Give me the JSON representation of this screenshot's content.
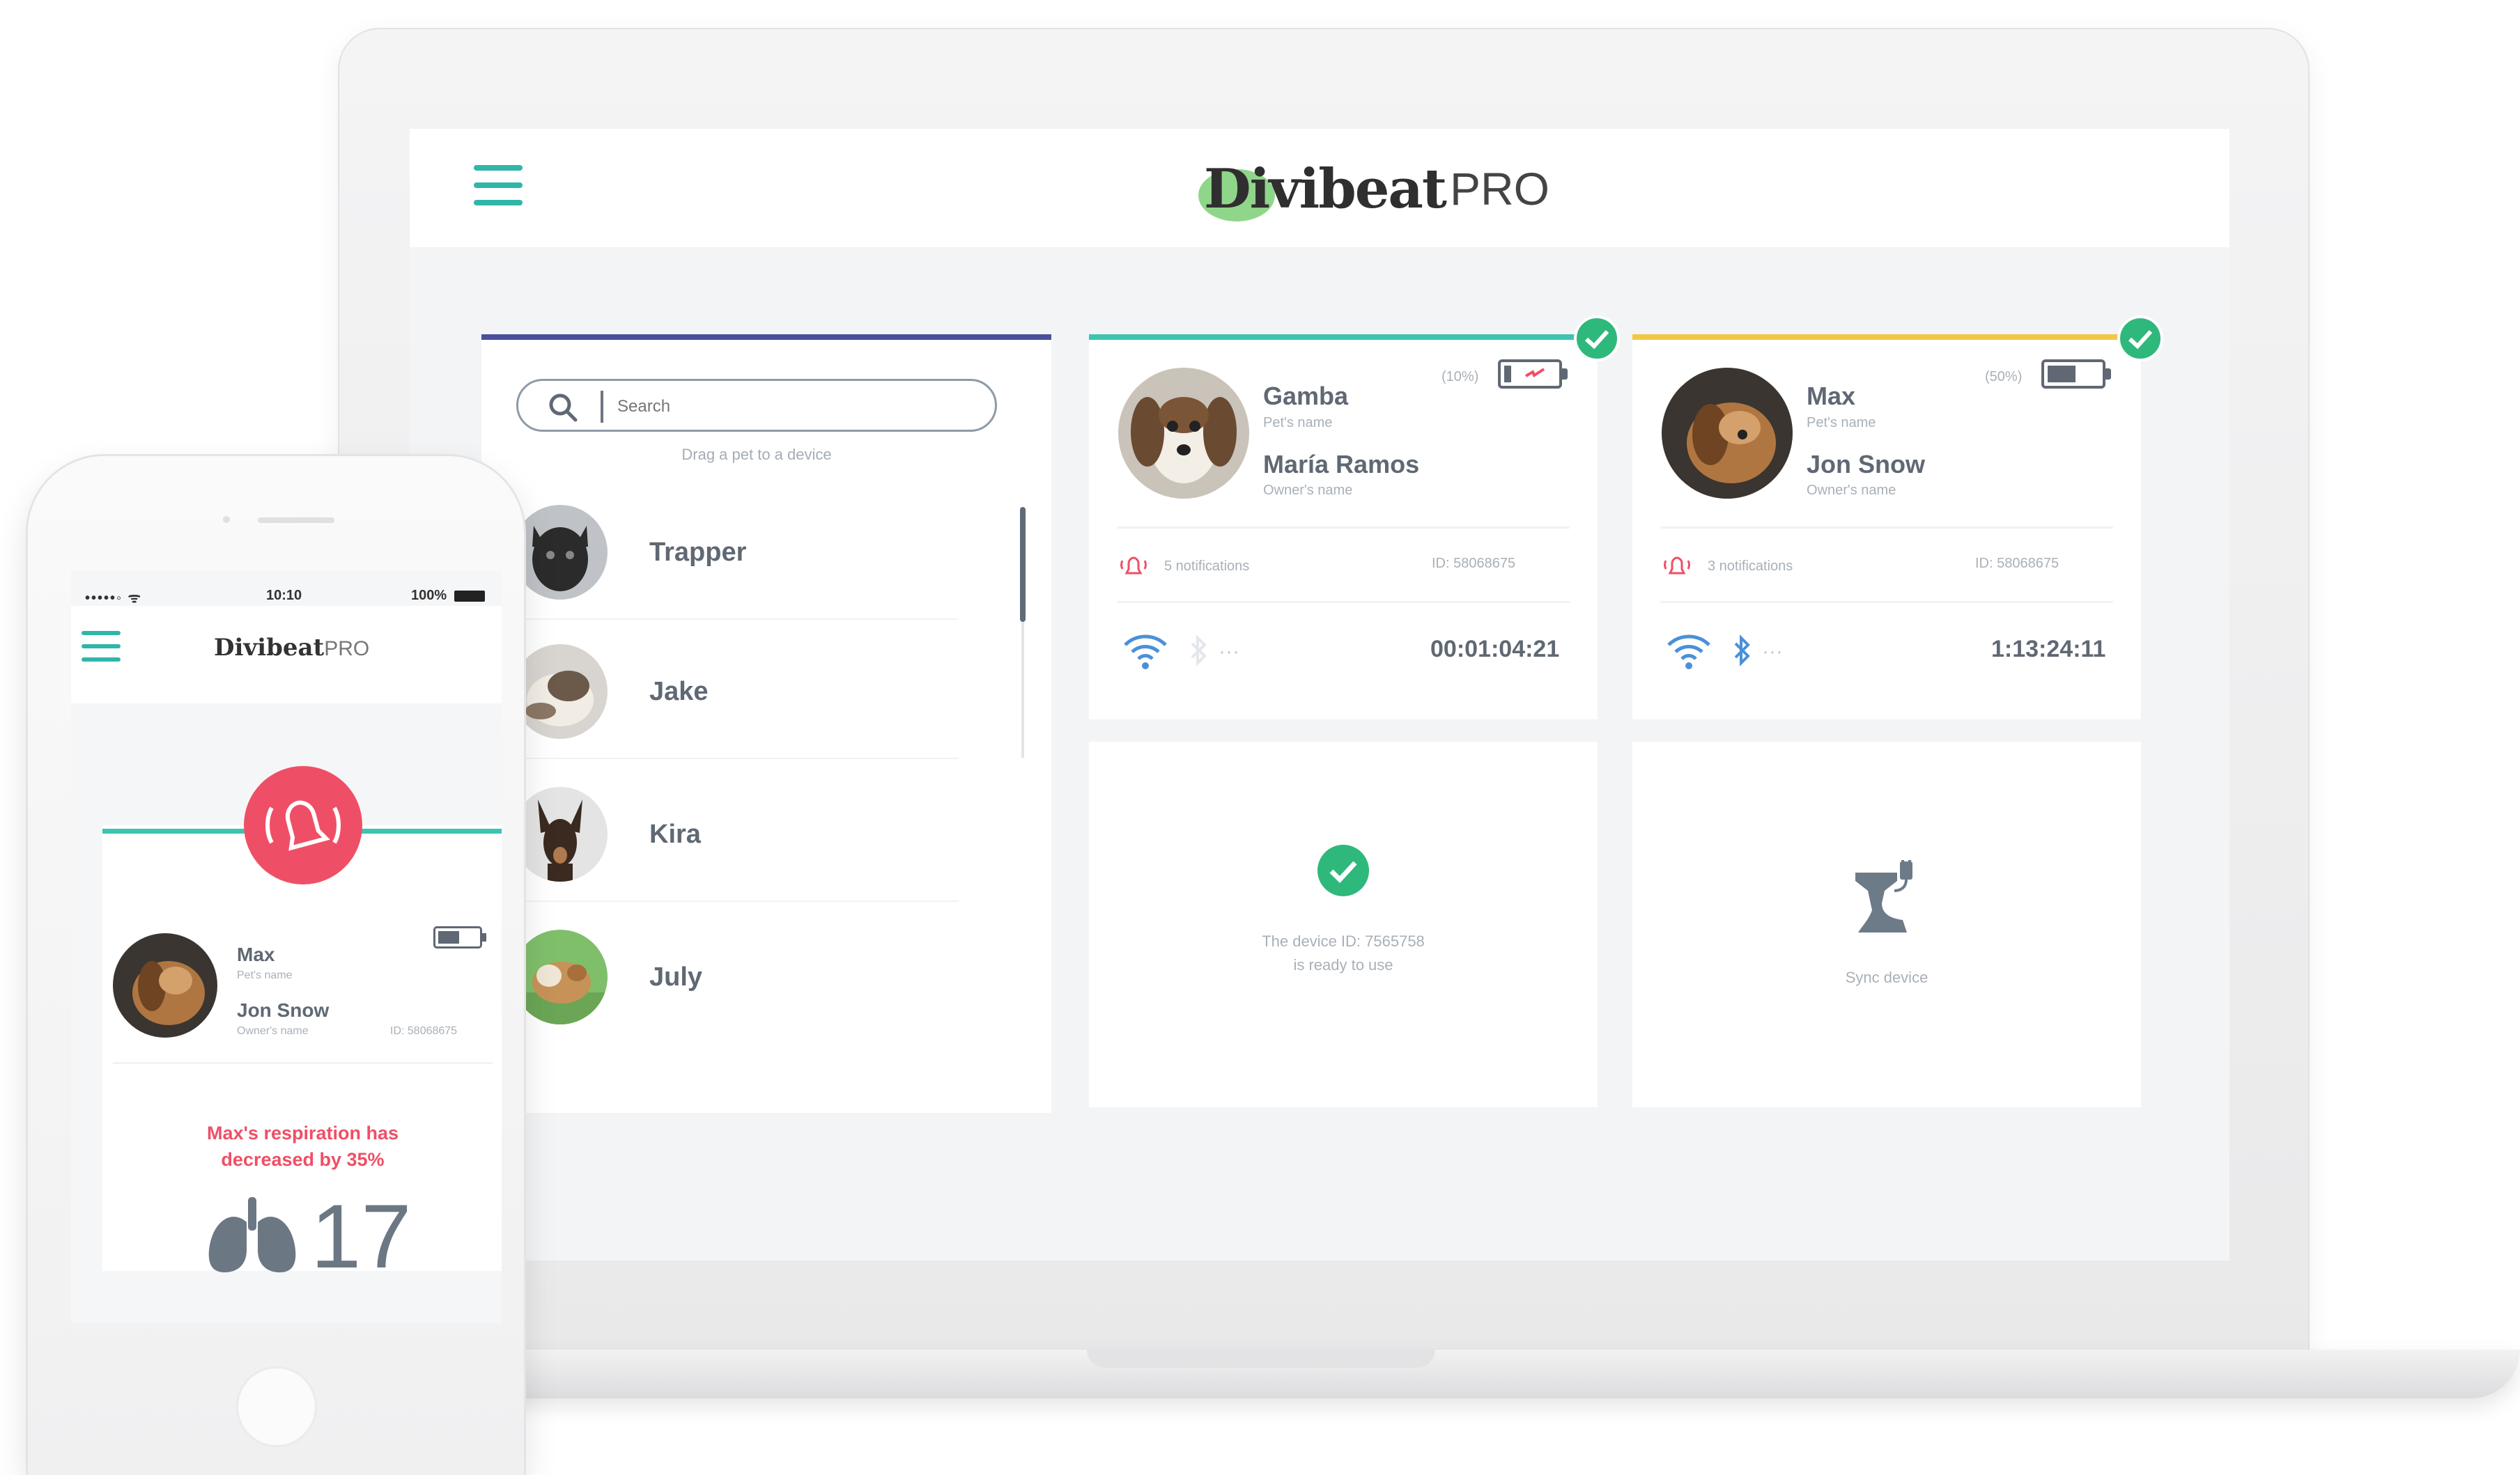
{
  "app": {
    "logo_main": "Divibeat",
    "logo_suffix": "PRO"
  },
  "pet_list": {
    "search_placeholder": "Search",
    "hint": "Drag a pet to a device",
    "pets": [
      {
        "name": "Trapper"
      },
      {
        "name": "Jake"
      },
      {
        "name": "Kira"
      },
      {
        "name": "July"
      }
    ]
  },
  "devices": [
    {
      "pet_name": "Gamba",
      "pet_label": "Pet's name",
      "owner_name": "María Ramos",
      "owner_label": "Owner's name",
      "battery_text": "(10%)",
      "battery_level": 0.1,
      "notifications": "5 notifications",
      "device_id": "ID: 58068675",
      "timer": "00:01:04:21",
      "accent": "#3cc4b0",
      "bluetooth_active": false
    },
    {
      "pet_name": "Max",
      "pet_label": "Pet's name",
      "owner_name": "Jon Snow",
      "owner_label": "Owner's name",
      "battery_text": "(50%)",
      "battery_level": 0.5,
      "notifications": "3 notifications",
      "device_id": "ID: 58068675",
      "timer": "1:13:24:11",
      "accent": "#f2c744",
      "bluetooth_active": true
    }
  ],
  "status_cards": [
    {
      "text_line1": "The device ID: 7565758",
      "text_line2": "is ready to use"
    },
    {
      "text": "Sync device"
    }
  ],
  "phone": {
    "status_time": "10:10",
    "status_battery": "100%",
    "pet_name": "Max",
    "pet_label": "Pet's name",
    "owner_name": "Jon Snow",
    "owner_label": "Owner's name",
    "device_id": "ID: 58068675",
    "alert_line1": "Max's respiration has",
    "alert_line2": "decreased by 35%",
    "respiration_value": "17",
    "battery_level": 0.5
  },
  "colors": {
    "teal": "#2fb6a8",
    "check_green": "#2fb87b",
    "alarm_red": "#ef4f66",
    "panel_indigo": "#4a4f9c",
    "accent_yellow": "#f2c744",
    "text_grey": "#5f6873"
  }
}
